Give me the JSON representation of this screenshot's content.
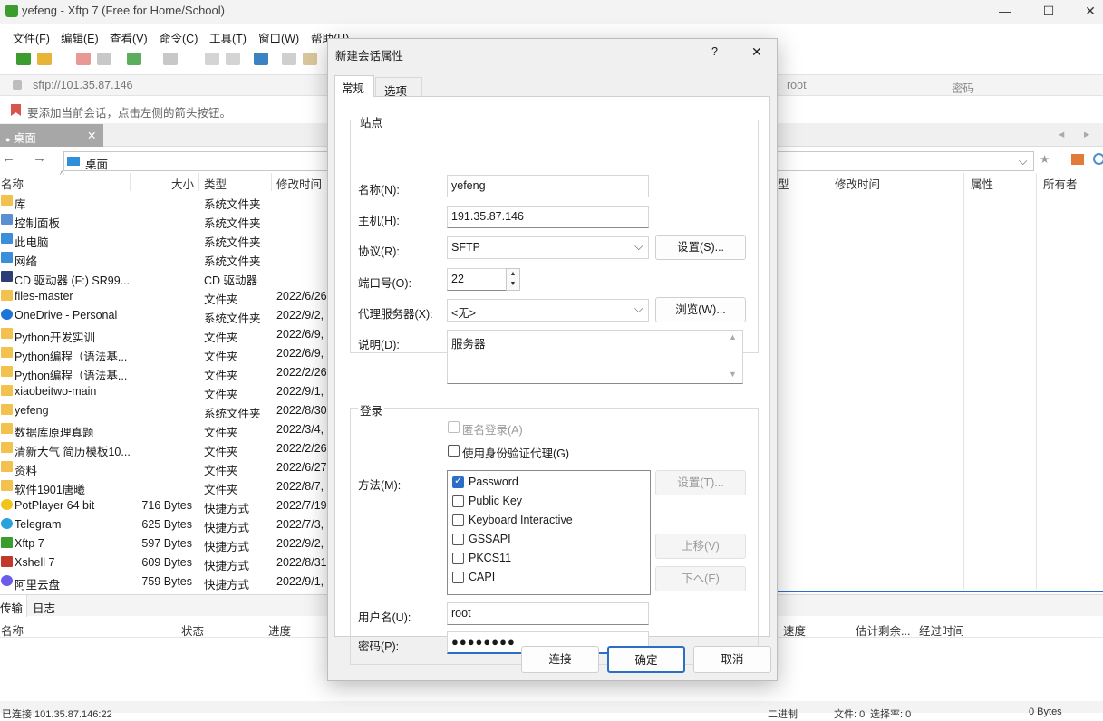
{
  "window": {
    "title": "yefeng - Xftp 7 (Free for Home/School)",
    "minimize": "—",
    "maximize": "☐",
    "close": "✕"
  },
  "menu": [
    "文件(F)",
    "编辑(E)",
    "查看(V)",
    "命令(C)",
    "工具(T)",
    "窗口(W)",
    "帮助(H)"
  ],
  "address": {
    "url": "sftp://101.35.87.146",
    "user_placeholder": "root",
    "password_placeholder": "密码"
  },
  "hint": "要添加当前会话，点击左侧的箭头按钮。",
  "tab": "桌面",
  "local_path": "桌面",
  "columns_left": [
    "名称",
    "大小",
    "类型",
    "修改时间"
  ],
  "columns_right": [
    "型",
    "修改时间",
    "属性",
    "所有者"
  ],
  "files": [
    {
      "name": "库",
      "size": "",
      "type": "系统文件夹",
      "date": "",
      "icon": "folder"
    },
    {
      "name": "控制面板",
      "size": "",
      "type": "系统文件夹",
      "date": "",
      "icon": "control-panel"
    },
    {
      "name": "此电脑",
      "size": "",
      "type": "系统文件夹",
      "date": "",
      "icon": "computer"
    },
    {
      "name": "网络",
      "size": "",
      "type": "系统文件夹",
      "date": "",
      "icon": "network"
    },
    {
      "name": "CD 驱动器 (F:) SR99...",
      "size": "",
      "type": "CD 驱动器",
      "date": "",
      "icon": "cd"
    },
    {
      "name": "files-master",
      "size": "",
      "type": "文件夹",
      "date": "2022/6/26",
      "icon": "folder"
    },
    {
      "name": "OneDrive - Personal",
      "size": "",
      "type": "系统文件夹",
      "date": "2022/9/2,",
      "icon": "cloud"
    },
    {
      "name": "Python开发实训",
      "size": "",
      "type": "文件夹",
      "date": "2022/6/9,",
      "icon": "folder"
    },
    {
      "name": "Python编程（语法基...",
      "size": "",
      "type": "文件夹",
      "date": "2022/6/9,",
      "icon": "folder"
    },
    {
      "name": "Python编程（语法基...",
      "size": "",
      "type": "文件夹",
      "date": "2022/2/26",
      "icon": "folder"
    },
    {
      "name": "xiaobeitwo-main",
      "size": "",
      "type": "文件夹",
      "date": "2022/9/1,",
      "icon": "folder"
    },
    {
      "name": "yefeng",
      "size": "",
      "type": "系统文件夹",
      "date": "2022/8/30",
      "icon": "folder"
    },
    {
      "name": "数据库原理真题",
      "size": "",
      "type": "文件夹",
      "date": "2022/3/4,",
      "icon": "folder"
    },
    {
      "name": "清新大气 简历模板10...",
      "size": "",
      "type": "文件夹",
      "date": "2022/2/26",
      "icon": "folder"
    },
    {
      "name": "资料",
      "size": "",
      "type": "文件夹",
      "date": "2022/6/27",
      "icon": "folder"
    },
    {
      "name": "软件1901唐曦",
      "size": "",
      "type": "文件夹",
      "date": "2022/8/7,",
      "icon": "folder"
    },
    {
      "name": "PotPlayer 64 bit",
      "size": "716 Bytes",
      "type": "快捷方式",
      "date": "2022/7/19",
      "icon": "potplayer"
    },
    {
      "name": "Telegram",
      "size": "625 Bytes",
      "type": "快捷方式",
      "date": "2022/7/3,",
      "icon": "telegram"
    },
    {
      "name": "Xftp 7",
      "size": "597 Bytes",
      "type": "快捷方式",
      "date": "2022/9/2,",
      "icon": "xftp"
    },
    {
      "name": "Xshell 7",
      "size": "609 Bytes",
      "type": "快捷方式",
      "date": "2022/8/31",
      "icon": "xshell"
    },
    {
      "name": "阿里云盘",
      "size": "759 Bytes",
      "type": "快捷方式",
      "date": "2022/9/1,",
      "icon": "aliyun"
    }
  ],
  "transfer": {
    "tabs": [
      "传输",
      "日志"
    ],
    "columns_left": [
      "名称",
      "状态",
      "进度"
    ],
    "columns_right": [
      "速度",
      "估计剩余...",
      "经过时间"
    ]
  },
  "status": {
    "left": "已连接 101.35.87.146:22",
    "mode": "二进制",
    "files": "文件: 0",
    "selected": "选择率: 0",
    "bytes": "0 Bytes"
  },
  "dialog": {
    "title": "新建会话属性",
    "help": "?",
    "close": "✕",
    "tabs": [
      "常规",
      "选项"
    ],
    "site_group": "站点",
    "name_label": "名称(N):",
    "name_value": "yefeng",
    "host_label": "主机(H):",
    "host_value": "191.35.87.146",
    "protocol_label": "协议(R):",
    "protocol_value": "SFTP",
    "settings_button": "设置(S)...",
    "port_label": "端口号(O):",
    "port_value": "22",
    "proxy_label": "代理服务器(X):",
    "proxy_value": "<无>",
    "browse_button": "浏览(W)...",
    "desc_label": "说明(D):",
    "desc_value": "服务器",
    "login_group": "登录",
    "anon_label": "匿名登录(A)",
    "agent_label": "使用身份验证代理(G)",
    "method_label": "方法(M):",
    "methods": [
      {
        "label": "Password",
        "checked": true
      },
      {
        "label": "Public Key",
        "checked": false
      },
      {
        "label": "Keyboard Interactive",
        "checked": false
      },
      {
        "label": "GSSAPI",
        "checked": false
      },
      {
        "label": "PKCS11",
        "checked": false
      },
      {
        "label": "CAPI",
        "checked": false
      }
    ],
    "method_settings": "设置(T)...",
    "move_up": "上移(V)",
    "move_down": "下へ(E)",
    "user_label": "用户名(U):",
    "user_value": "root",
    "pass_label": "密码(P):",
    "pass_value": "●●●●●●●●",
    "connect": "连接",
    "ok": "确定",
    "cancel": "取消"
  },
  "colors": {
    "accent": "#2b6fc4",
    "folder": "#f2c14e",
    "tab_active": "#a7a7a7"
  }
}
